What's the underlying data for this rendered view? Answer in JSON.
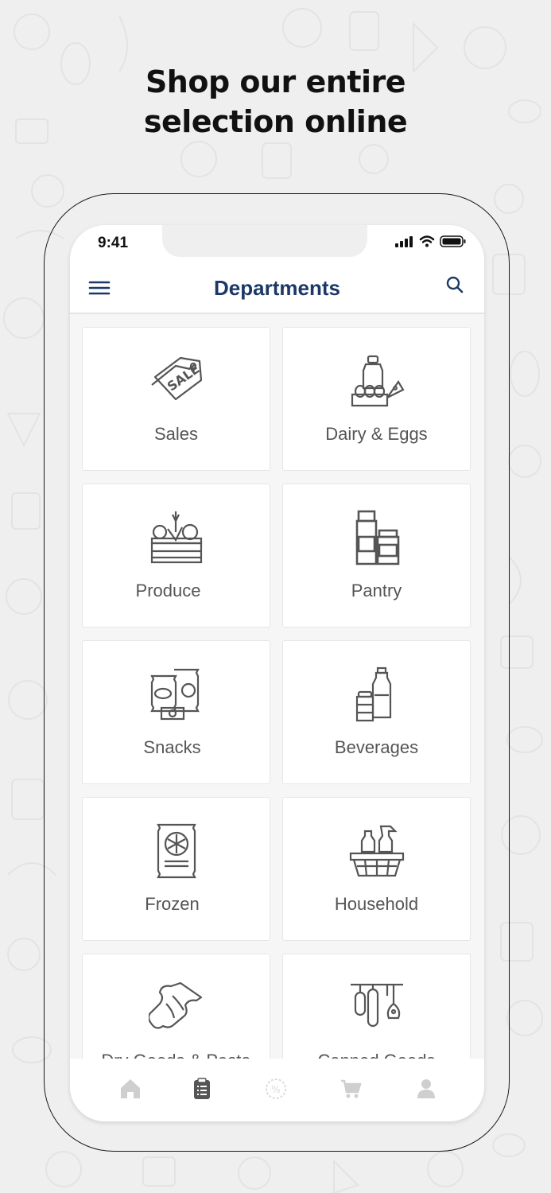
{
  "headline": {
    "line1": "Shop our entire",
    "line2": "selection online"
  },
  "status_bar": {
    "time": "9:41"
  },
  "header": {
    "title": "Departments"
  },
  "departments": [
    {
      "label": "Sales",
      "icon": "sale-tags-icon"
    },
    {
      "label": "Dairy & Eggs",
      "icon": "dairy-eggs-icon"
    },
    {
      "label": "Produce",
      "icon": "produce-crate-icon"
    },
    {
      "label": "Pantry",
      "icon": "pantry-jars-icon"
    },
    {
      "label": "Snacks",
      "icon": "snack-bags-icon"
    },
    {
      "label": "Beverages",
      "icon": "beverage-bottles-icon"
    },
    {
      "label": "Frozen",
      "icon": "frozen-bag-icon"
    },
    {
      "label": "Household",
      "icon": "household-basket-icon"
    },
    {
      "label": "Dry Goods & Pasta",
      "icon": "pasta-icon"
    },
    {
      "label": "Canned Goods",
      "icon": "hanging-meats-icon"
    }
  ],
  "tabbar": {
    "tabs": [
      "home-icon",
      "list-icon",
      "discount-icon",
      "cart-icon",
      "profile-icon"
    ],
    "active": "list-icon"
  },
  "colors": {
    "brand": "#1b3866",
    "icon_gray": "#555555",
    "tab_inactive": "#cfcfcf",
    "tab_active": "#555555"
  }
}
